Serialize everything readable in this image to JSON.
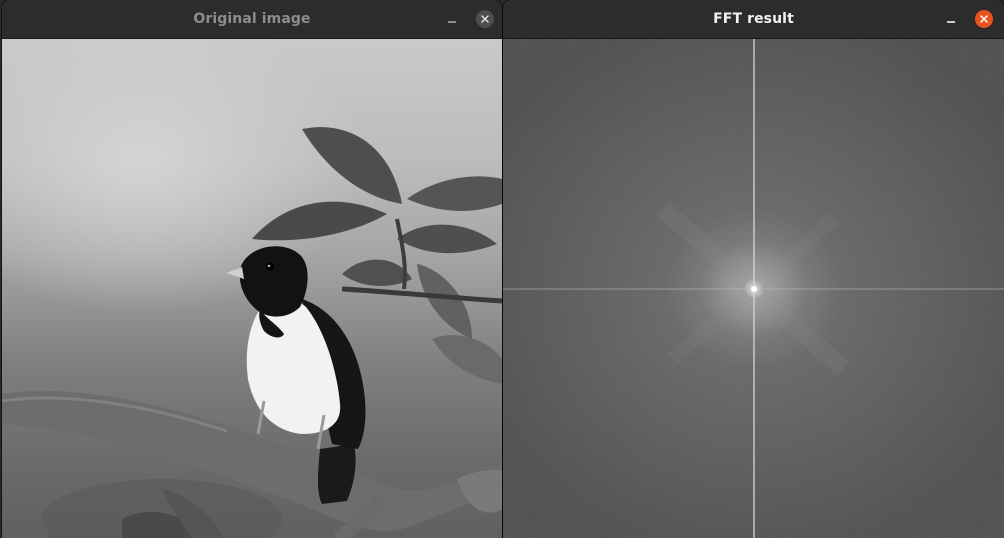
{
  "windows": [
    {
      "title": "Original image",
      "state": "inactive",
      "controls": {
        "minimize_icon": "minimize-icon",
        "close_icon": "close-icon"
      }
    },
    {
      "title": "FFT result",
      "state": "active",
      "controls": {
        "minimize_icon": "minimize-icon",
        "close_icon": "close-icon"
      }
    }
  ],
  "colors": {
    "titlebar": "#2c2c2c",
    "active_title": "#f2f2f2",
    "inactive_title": "#8d8d8d",
    "close_active": "#e95420",
    "close_inactive": "#4d4d4d"
  }
}
